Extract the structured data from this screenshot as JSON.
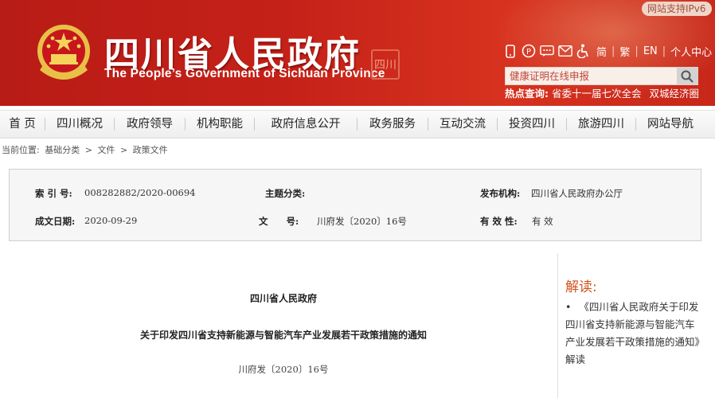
{
  "header": {
    "title_cn": "四川省人民政府",
    "title_en": "The People’s Government of Sichuan Province",
    "seal_text": "四川",
    "ipv6_badge": "网站支持IPv6",
    "tools": {
      "simplified": "简",
      "traditional": "繁",
      "english": "EN",
      "personal_center": "个人中心",
      "separator": "|"
    },
    "search": {
      "placeholder": "健康证明在线申报"
    },
    "hot": {
      "label": "热点查询:",
      "items": [
        "省委十一届七次全会",
        "双城经济圈"
      ]
    }
  },
  "nav": {
    "items": [
      "首 页",
      "四川概况",
      "政府领导",
      "机构职能",
      "政府信息公开",
      "政务服务",
      "互动交流",
      "投资四川",
      "旅游四川",
      "网站导航"
    ]
  },
  "breadcrumb": {
    "prefix": "当前位置:",
    "items": [
      "基础分类",
      "文件",
      "政策文件"
    ],
    "sep": ">"
  },
  "info": {
    "index_label": "索 引 号:",
    "index_value": "008282882/2020-00694",
    "topic_label": "主题分类:",
    "topic_value": "",
    "publisher_label": "发布机构:",
    "publisher_value": "四川省人民政府办公厅",
    "date_label": "成文日期:",
    "date_value": "2020-09-29",
    "docno_label": "文　　号:",
    "docno_value": "川府发〔2020〕16号",
    "validity_label": "有 效 性:",
    "validity_value": "有 效"
  },
  "article": {
    "org": "四川省人民政府",
    "title": "关于印发四川省支持新能源与智能汽车产业发展若干政策措施的通知",
    "doc_no": "川府发〔2020〕16号"
  },
  "side": {
    "title": "解读:",
    "bullet": "•",
    "item": "《四川省人民政府关于印发四川省支持新能源与智能汽车产业发展若干政策措施的通知》解读"
  },
  "colors": {
    "header_red": "#c52118",
    "accent_orange": "#d2541f"
  }
}
